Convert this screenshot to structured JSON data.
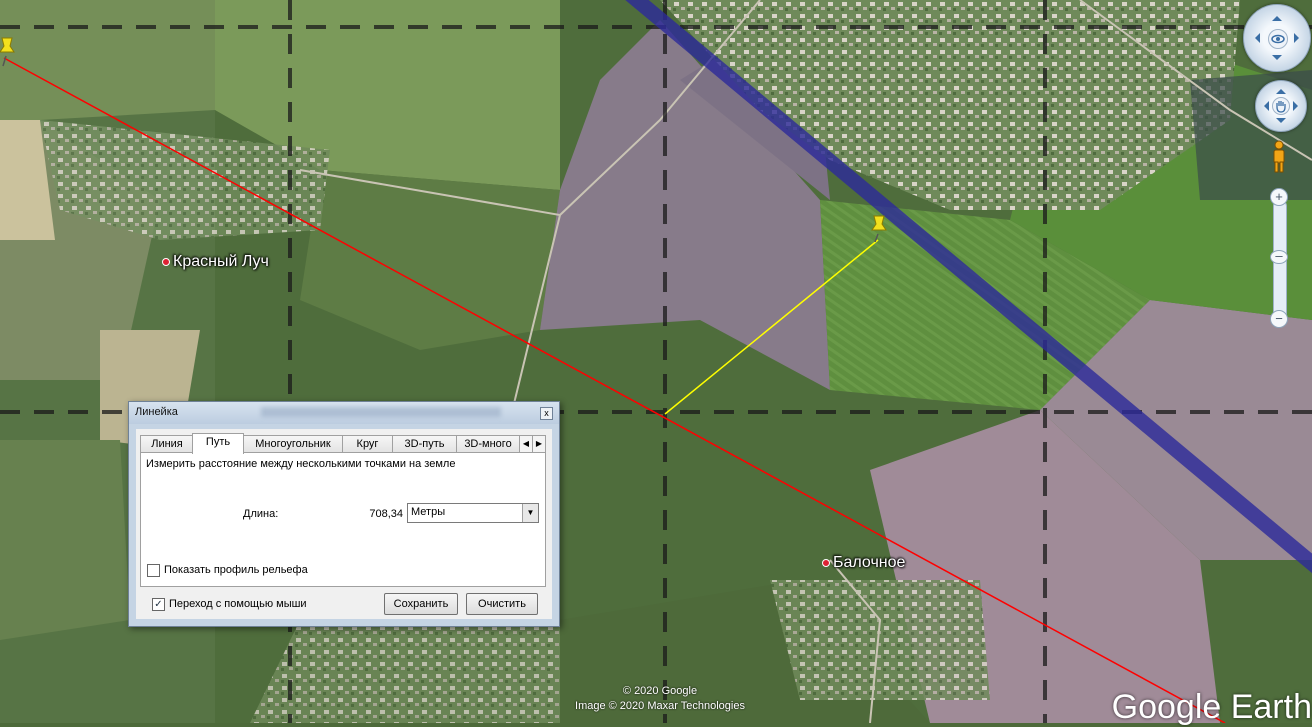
{
  "map": {
    "places": [
      {
        "name": "Красный Луч"
      },
      {
        "name": "Балочное"
      }
    ],
    "copyright_line1": "© 2020 Google",
    "copyright_line2": "Image © 2020 Maxar Technologies",
    "logo": "Google Earth",
    "path_color": "#ff0000",
    "segment_color": "#ffff00",
    "boundary_color": "#2d2a9a"
  },
  "nav": {
    "look_icon": "eye-icon",
    "move_icon": "hand-icon",
    "streetview_icon": "pegman-icon",
    "zoom_in": "+",
    "zoom_out": "−"
  },
  "ruler": {
    "title": "Линейка",
    "close": "x",
    "tabs": [
      {
        "label": "Линия"
      },
      {
        "label": "Путь"
      },
      {
        "label": "Многоугольник"
      },
      {
        "label": "Круг"
      },
      {
        "label": "3D-путь"
      },
      {
        "label": "3D-много"
      }
    ],
    "active_tab": "Путь",
    "description": "Измерить расстояние между несколькими точками на земле",
    "length_label": "Длина:",
    "length_value": "708,34",
    "unit": "Метры",
    "show_profile_label": "Показать профиль рельефа",
    "show_profile_checked": false,
    "mouse_nav_label": "Переход с помощью мыши",
    "mouse_nav_checked": true,
    "save_label": "Сохранить",
    "clear_label": "Очистить"
  }
}
